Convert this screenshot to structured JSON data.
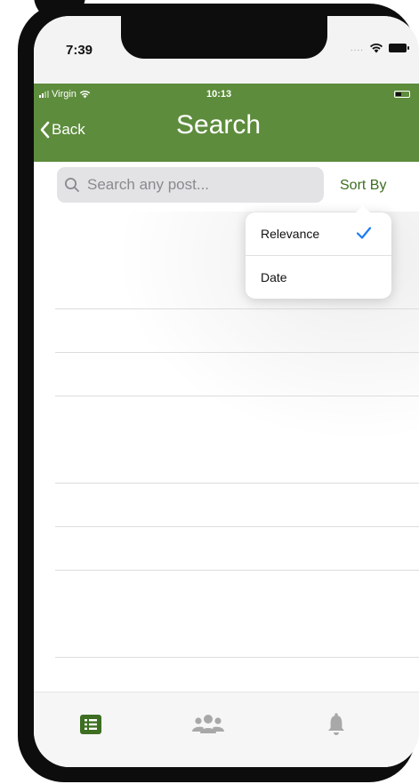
{
  "device_status": {
    "time": "7:39",
    "dots": "....",
    "icons": [
      "wifi-icon",
      "battery-icon"
    ]
  },
  "app_status": {
    "carrier": "Virgin",
    "time": "10:13",
    "icons": [
      "signal-icon",
      "wifi-icon",
      "battery-icon"
    ]
  },
  "header": {
    "back_label": "Back",
    "title": "Search",
    "background_color": "#5d8c3c"
  },
  "search": {
    "placeholder": "Search any post...",
    "value": ""
  },
  "sort": {
    "label": "Sort By",
    "label_color": "#3d6e21",
    "options": [
      {
        "label": "Relevance",
        "selected": true
      },
      {
        "label": "Date",
        "selected": false
      }
    ],
    "check_color": "#1a7cf5"
  },
  "tab_bar": {
    "tabs": [
      {
        "icon": "list-icon",
        "active": true,
        "color": "#3d6e21"
      },
      {
        "icon": "groups-icon",
        "active": false,
        "color": "#a8a8a8"
      },
      {
        "icon": "bell-icon",
        "active": false,
        "color": "#a8a8a8"
      }
    ]
  }
}
